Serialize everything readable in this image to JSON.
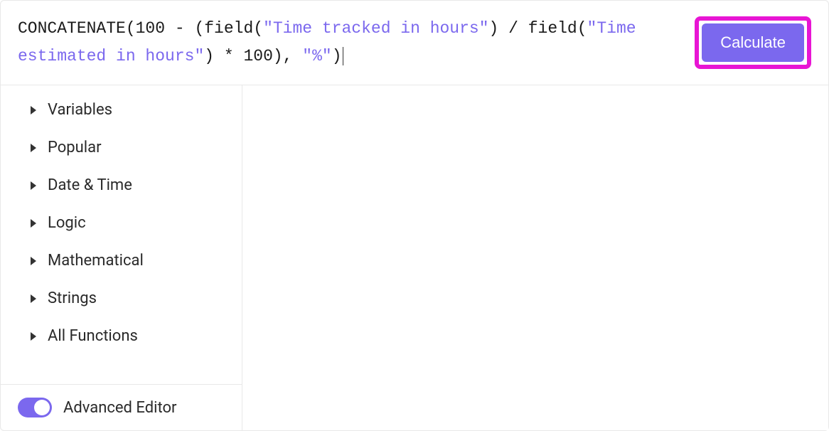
{
  "formula": {
    "parts": [
      {
        "type": "keyword",
        "text": "CONCATENATE(100 - (field("
      },
      {
        "type": "string",
        "text": "\"Time tracked in hours\""
      },
      {
        "type": "keyword",
        "text": ") / field("
      },
      {
        "type": "string",
        "text": "\"Time estimated in hours\""
      },
      {
        "type": "keyword",
        "text": ") * 100), "
      },
      {
        "type": "string",
        "text": "\"%\""
      },
      {
        "type": "keyword",
        "text": ")"
      }
    ]
  },
  "calculate_button": "Calculate",
  "categories": [
    "Variables",
    "Popular",
    "Date & Time",
    "Logic",
    "Mathematical",
    "Strings",
    "All Functions"
  ],
  "advanced_editor_label": "Advanced Editor",
  "advanced_editor_enabled": true
}
